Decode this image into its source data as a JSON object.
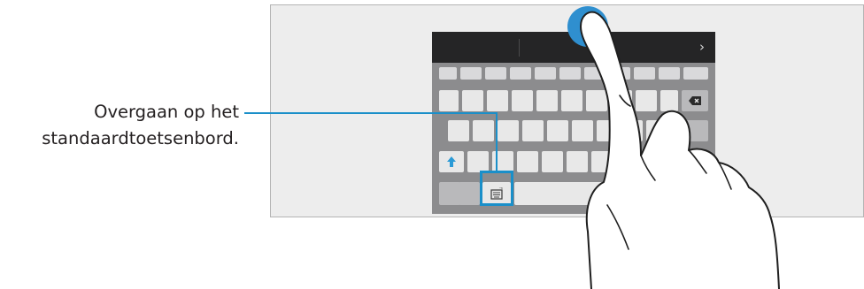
{
  "callout": {
    "line1": "Overgaan op het",
    "line2": "standaardtoetsenbord."
  },
  "keyboard": {
    "topbar_chevron": "›",
    "icons": {
      "backspace": "backspace-icon",
      "shift": "shift-icon",
      "keyboard_switch": "keyboard-switch-icon",
      "space": "space-icon",
      "expand": "chevron-right-icon"
    }
  },
  "colors": {
    "highlight": "#1a8fc9",
    "shift_blue": "#2a9ad6",
    "touch_blue": "#2f8fcf",
    "topbar": "#252526",
    "keyboard_bg": "#8c8c8e"
  }
}
